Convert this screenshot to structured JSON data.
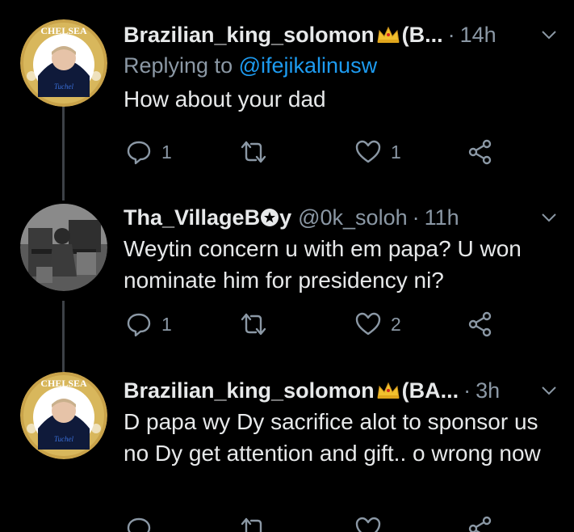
{
  "theme": {
    "background": "#000000",
    "text": "#e7e9ea",
    "muted": "#8b98a5",
    "link": "#1d9bf0",
    "thread_line": "#3d4147",
    "crest_gold": "#c9a34a"
  },
  "tweets": [
    {
      "avatar_icon": "chelsea-crest-avatar",
      "display_name": "Brazilian_king_solomon",
      "name_badge": "crown-emoji",
      "name_suffix": "(B...",
      "separator": "·",
      "time": "14h",
      "replying_label": "Replying to",
      "replying_handle": "@ifejikalinusw",
      "text": "How about your dad",
      "reply_count": "1",
      "like_count": "1"
    },
    {
      "avatar_icon": "gym-photo-avatar",
      "display_name": "Tha_VillageB",
      "name_badge": "star-in-circle",
      "name_suffix": "y",
      "handle": "@0k_soloh",
      "separator": "·",
      "time": "11h",
      "text": "Weytin concern u with em papa? U won nominate him for presidency ni?",
      "reply_count": "1",
      "like_count": "2"
    },
    {
      "avatar_icon": "chelsea-crest-avatar",
      "display_name": "Brazilian_king_solomon",
      "name_badge": "crown-emoji",
      "name_suffix": "(BA...",
      "separator": "·",
      "time": "3h",
      "text": "D papa wy Dy sacrifice alot to sponsor us no Dy get attention and gift.. o wrong now"
    }
  ]
}
